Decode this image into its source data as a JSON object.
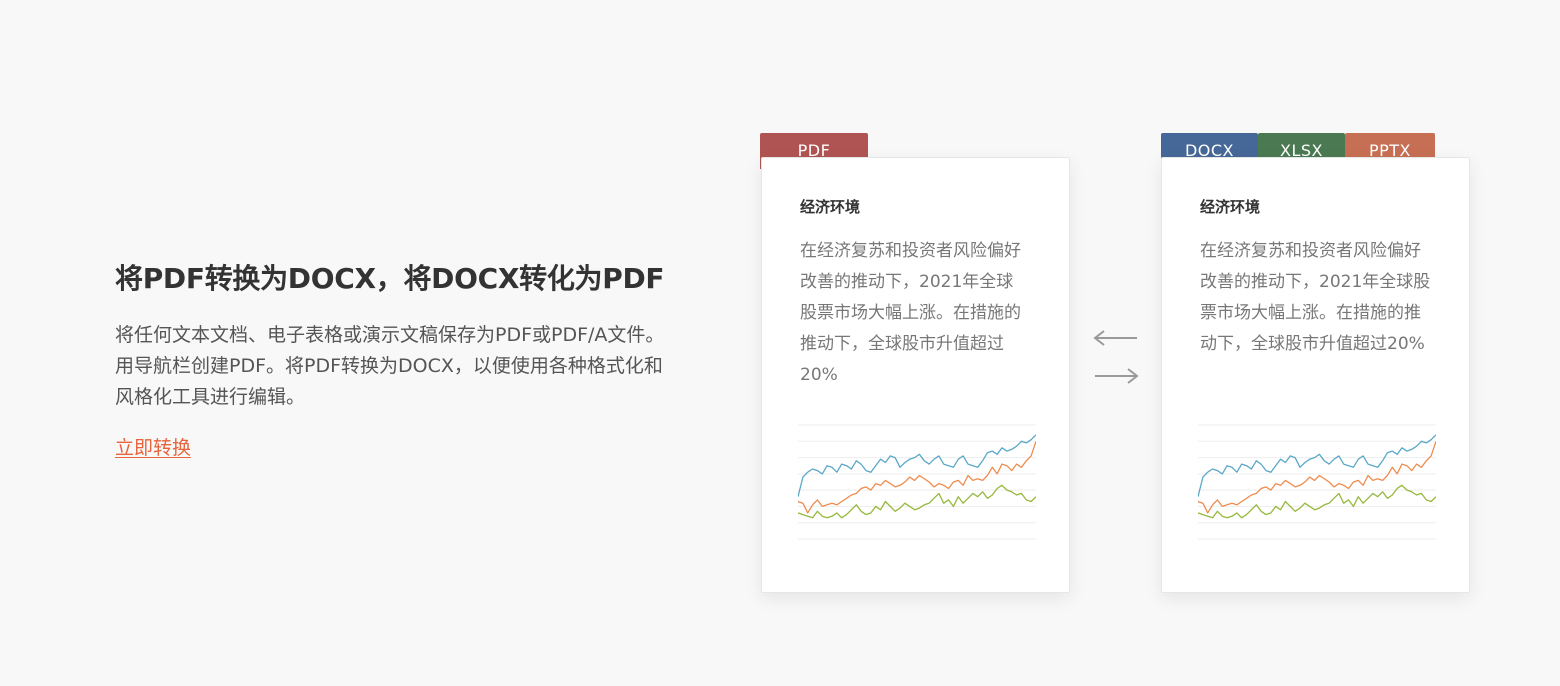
{
  "hero": {
    "title": "将PDF转换为DOCX，将DOCX转化为PDF",
    "description": "将任何文本文档、电子表格或演示文稿保存为PDF或PDF/A文件。用导航栏创建PDF。将PDF转换为DOCX，以便使用各种格式化和风格化工具进行编辑。",
    "cta_label": "立即转换",
    "cta_color": "#e8643c"
  },
  "source_card": {
    "tabs": [
      {
        "label": "PDF",
        "color": "#b05453"
      }
    ],
    "heading": "经济环境",
    "body": "在经济复苏和投资者风险偏好改善的推动下，2021年全球股票市场大幅上涨。在措施的推动下，全球股市升值超过 20%"
  },
  "target_card": {
    "tabs": [
      {
        "label": "DOCX",
        "color": "#466898"
      },
      {
        "label": "XLSX",
        "color": "#4b7a52"
      },
      {
        "label": "PPTX",
        "color": "#c76f54"
      }
    ],
    "heading": "经济环境",
    "body": "在经济复苏和投资者风险偏好改善的推动下，2021年全球股票市场大幅上涨。在措施的推动下，全球股市升值超过20%"
  },
  "arrows": {
    "left_icon": "arrow-left-icon",
    "right_icon": "arrow-right-icon",
    "color": "#9a9a9a"
  },
  "chart_data": {
    "type": "line",
    "x": [
      0,
      1,
      2,
      3,
      4,
      5,
      6,
      7,
      8,
      9,
      10,
      11,
      12,
      13,
      14,
      15,
      16,
      17,
      18,
      19,
      20,
      21,
      22,
      23,
      24,
      25,
      26,
      27,
      28,
      29,
      30,
      31,
      32,
      33,
      34,
      35,
      36,
      37,
      38,
      39,
      40,
      41,
      42,
      43,
      44,
      45,
      46,
      47,
      48,
      49
    ],
    "ylim": [
      0,
      7
    ],
    "grid": true,
    "series": [
      {
        "color": "#5aa8c8",
        "values": [
          2.6,
          3.8,
          4.1,
          4.3,
          4.2,
          4.0,
          4.5,
          4.4,
          4.1,
          4.6,
          4.5,
          4.3,
          4.8,
          4.6,
          4.2,
          4.1,
          4.5,
          4.9,
          4.7,
          5.1,
          5.0,
          4.4,
          4.7,
          4.9,
          5.0,
          5.2,
          4.8,
          4.6,
          4.9,
          5.1,
          4.6,
          4.5,
          4.4,
          4.9,
          5.1,
          4.6,
          4.5,
          4.4,
          4.8,
          5.3,
          5.4,
          5.2,
          5.6,
          5.4,
          5.5,
          5.7,
          6.0,
          5.9,
          6.1,
          6.4
        ]
      },
      {
        "color": "#ef8c4e",
        "values": [
          2.3,
          2.2,
          1.6,
          2.1,
          2.4,
          2.0,
          2.1,
          2.2,
          2.1,
          2.3,
          2.5,
          2.7,
          2.8,
          3.1,
          3.2,
          3.0,
          3.4,
          3.3,
          3.6,
          3.4,
          3.2,
          3.3,
          3.5,
          3.8,
          3.6,
          3.9,
          3.7,
          3.5,
          3.2,
          3.4,
          3.3,
          3.1,
          3.5,
          3.6,
          3.3,
          3.9,
          3.6,
          3.7,
          3.6,
          3.9,
          4.4,
          4.0,
          4.6,
          4.5,
          4.2,
          4.6,
          4.4,
          4.8,
          5.1,
          6.0
        ]
      },
      {
        "color": "#96b83c",
        "values": [
          1.6,
          1.5,
          1.4,
          1.3,
          1.7,
          1.4,
          1.3,
          1.4,
          1.6,
          1.3,
          1.5,
          1.8,
          2.1,
          1.7,
          1.5,
          1.6,
          2.0,
          1.8,
          2.3,
          2.0,
          1.7,
          1.9,
          2.2,
          2.0,
          1.8,
          1.9,
          2.1,
          2.2,
          2.5,
          2.8,
          2.2,
          2.4,
          2.0,
          2.6,
          2.2,
          2.5,
          2.8,
          2.6,
          2.9,
          2.5,
          2.7,
          3.1,
          3.3,
          3.0,
          2.9,
          2.7,
          2.8,
          2.4,
          2.3,
          2.6
        ]
      }
    ]
  }
}
